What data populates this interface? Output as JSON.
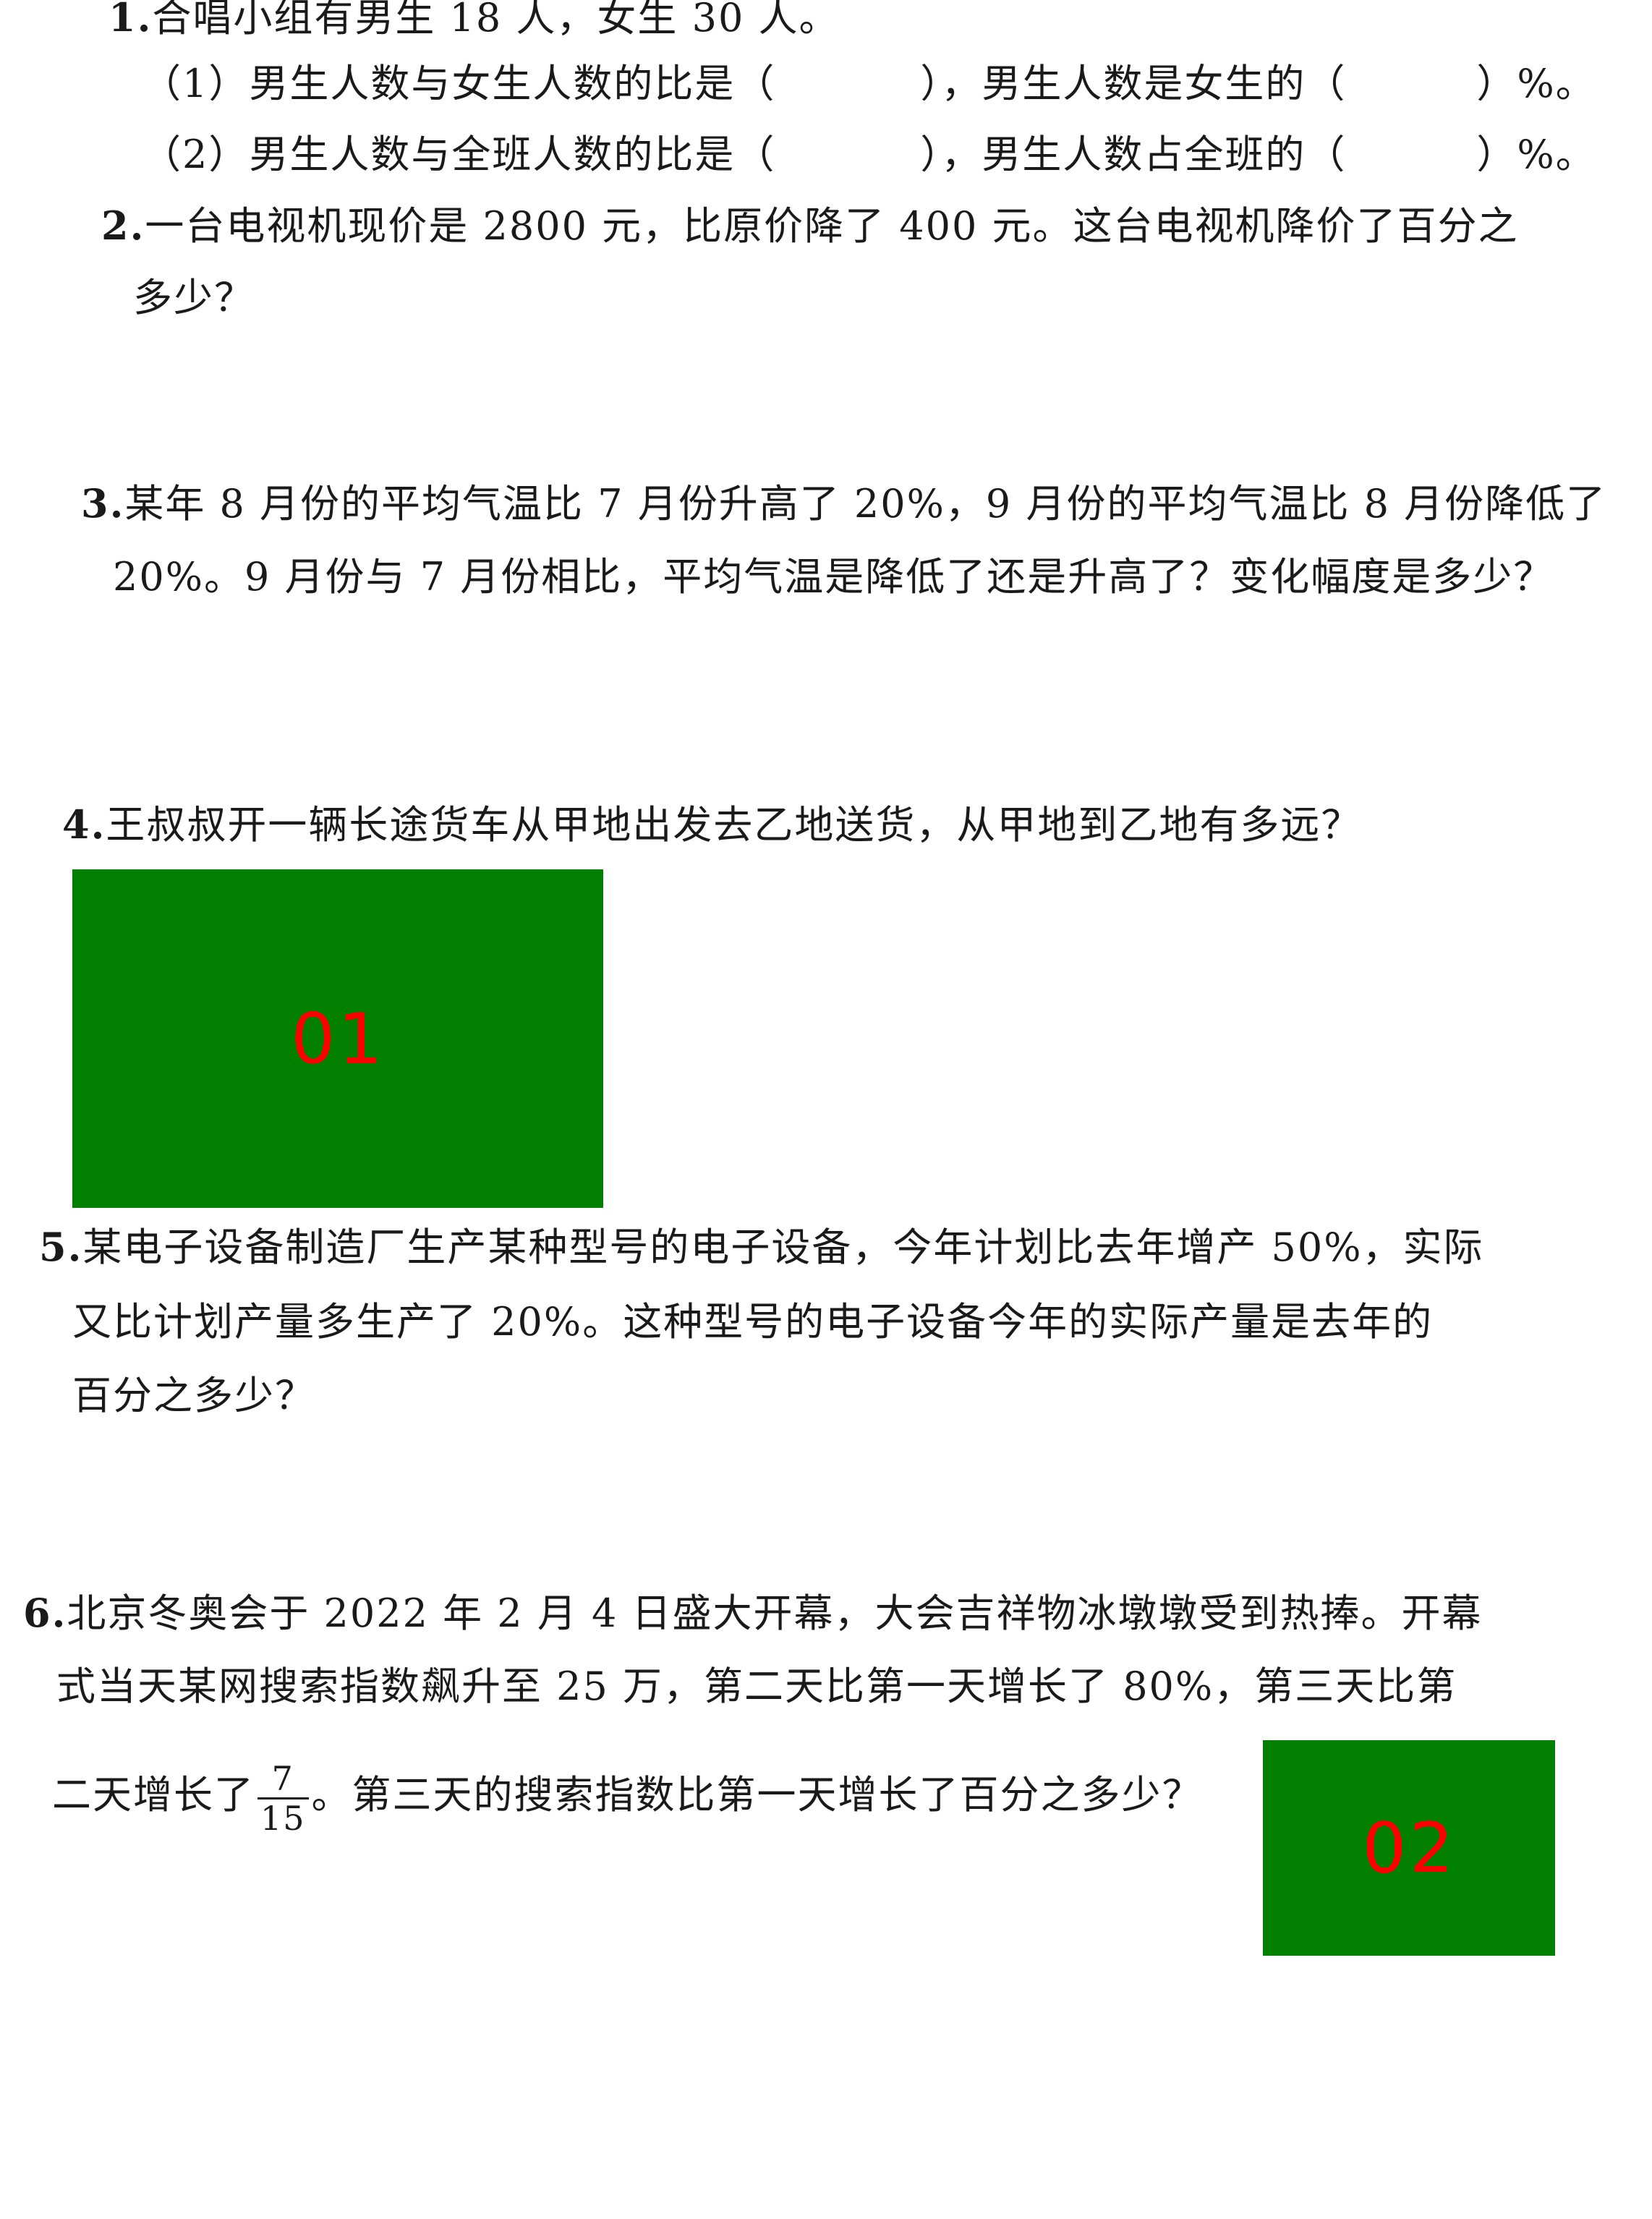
{
  "questions": {
    "q1": {
      "number": "1.",
      "stem": "合唱小组有男生 18 人，女生 30 人。",
      "part1_a": "（1）男生人数与女生人数的比是（",
      "part1_b": "），男生人数是女生的（",
      "part1_c": "）%。",
      "part2_a": "（2）男生人数与全班人数的比是（",
      "part2_b": "），男生人数占全班的（",
      "part2_c": "）%。"
    },
    "q2": {
      "number": "2.",
      "line1": "一台电视机现价是 2800 元，比原价降了 400 元。这台电视机降价了百分之",
      "line2": "多少？"
    },
    "q3": {
      "number": "3.",
      "line1": "某年 8 月份的平均气温比 7 月份升高了 20%，9 月份的平均气温比 8 月份降低了",
      "line2": "20%。9 月份与 7 月份相比，平均气温是降低了还是升高了？变化幅度是多少？"
    },
    "q4": {
      "number": "4.",
      "line1": "王叔叔开一辆长途货车从甲地出发去乙地送货，从甲地到乙地有多远？"
    },
    "q5": {
      "number": "5.",
      "line1": "某电子设备制造厂生产某种型号的电子设备，今年计划比去年增产 50%，实际",
      "line2": "又比计划产量多生产了 20%。这种型号的电子设备今年的实际产量是去年的",
      "line3": "百分之多少？"
    },
    "q6": {
      "number": "6.",
      "line1": "北京冬奥会于 2022 年 2 月 4 日盛大开幕，大会吉祥物冰墩墩受到热捧。开幕",
      "line2": "式当天某网搜索指数飙升至 25 万，第二天比第一天增长了 80%，第三天比第",
      "line3_a": "二天增长了",
      "fraction_numerator": "7",
      "fraction_denominator": "15",
      "line3_b": "。第三天的搜索指数比第一天增长了百分之多少？"
    }
  },
  "overlays": {
    "box1_label": "01",
    "box2_label": "02",
    "box_color": "#007f00",
    "label_color": "#ff0000"
  }
}
